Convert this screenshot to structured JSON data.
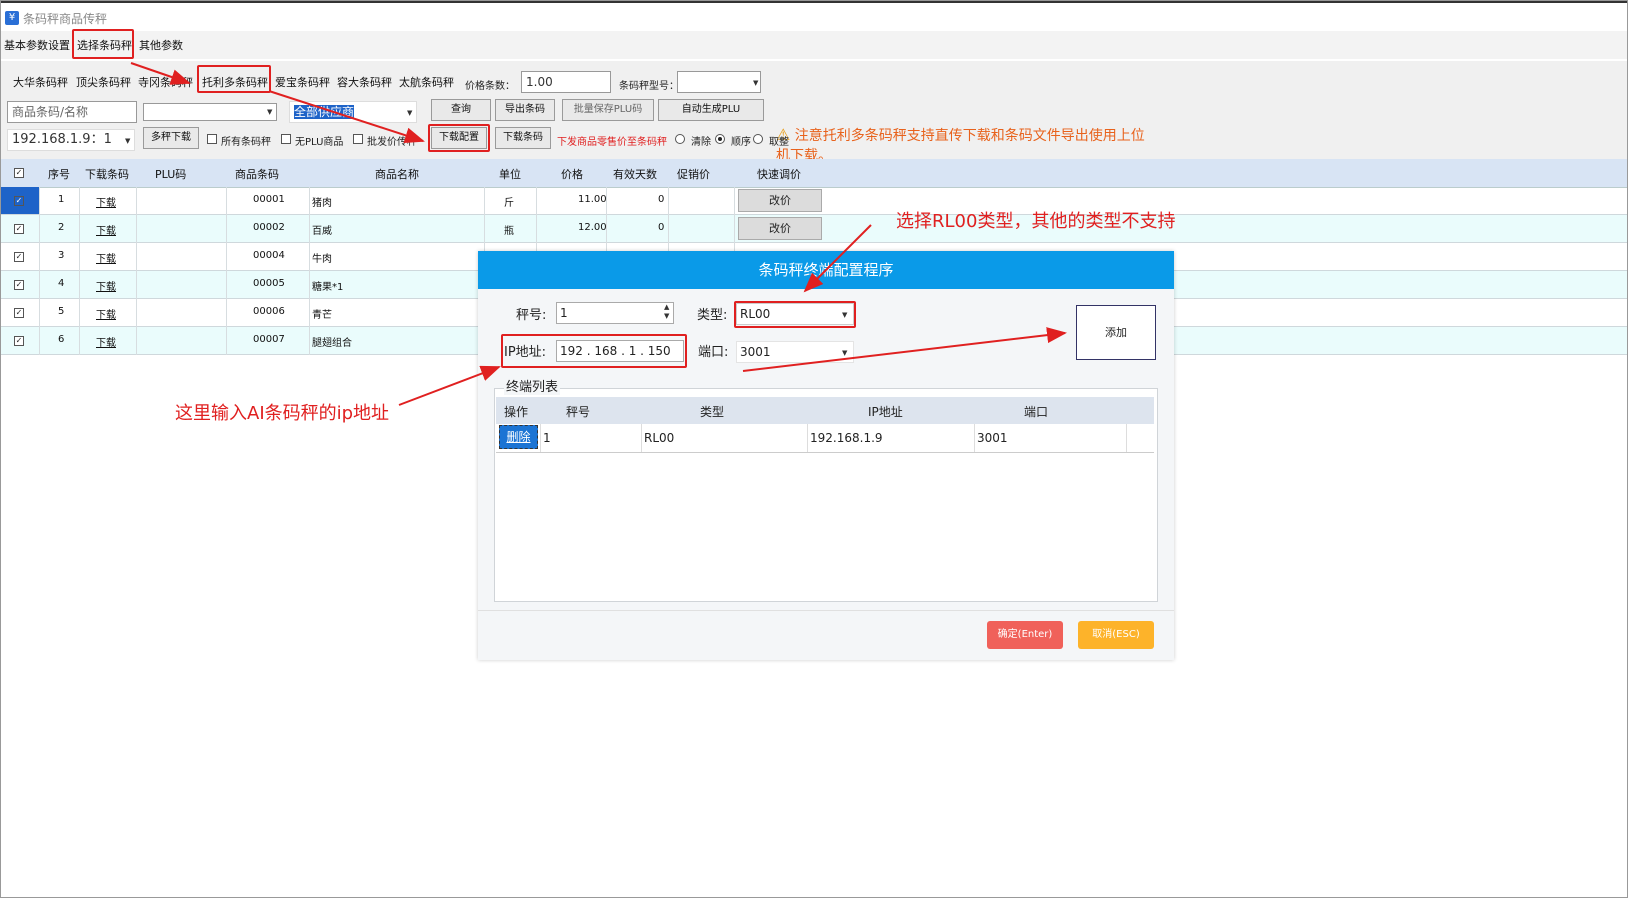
{
  "window": {
    "title": "条码秤商品传秤",
    "icon": "app-icon"
  },
  "top_tabs": [
    "基本参数设置",
    "选择条码秤",
    "其他参数"
  ],
  "scale_tabs": [
    "大华条码秤",
    "顶尖条码秤",
    "寺冈条码秤",
    "托利多条码秤",
    "爱宝条码秤",
    "容大条码秤",
    "太航条码秤"
  ],
  "toolbar": {
    "price_digits_label": "价格条数：",
    "price_digits_value": "1.00",
    "scale_model_label": "条码秤型号：",
    "search_placeholder": "商品条码/名称",
    "supplier_value": "全部供应商",
    "query": "查询",
    "export_barcode": "导出条码",
    "batch_save_plu": "批量保存PLU码",
    "auto_generate_plu": "自动生成PLU",
    "ip_select": "192.168.1.9：1",
    "multi_download": "多秤下载",
    "all_scales": "所有条码秤",
    "no_plu": "无PLU商品",
    "wholesale_scale": "批发价传秤",
    "download_config": "下载配置",
    "download_barcode": "下载条码",
    "retail_notice": "下发商品零售价至条码秤",
    "clear": "清除",
    "order": "顺序",
    "round": "取整"
  },
  "warning": "注意托利多条码秤支持直传下载和条码文件导出使用上位机下载。",
  "grid": {
    "headers": [
      "序号",
      "下载条码",
      "PLU码",
      "商品条码",
      "商品名称",
      "单位",
      "价格",
      "有效天数",
      "促销价",
      "快速调价"
    ],
    "rows": [
      {
        "no": "1",
        "dl": "下载",
        "plu": "",
        "code": "00001",
        "name": "猪肉",
        "unit": "斤",
        "price": "11.00",
        "days": "0",
        "promo": "",
        "btn": "改价"
      },
      {
        "no": "2",
        "dl": "下载",
        "plu": "",
        "code": "00002",
        "name": "百威",
        "unit": "瓶",
        "price": "12.00",
        "days": "0",
        "promo": "",
        "btn": "改价"
      },
      {
        "no": "3",
        "dl": "下载",
        "plu": "",
        "code": "00004",
        "name": "牛肉",
        "unit": "",
        "price": "",
        "days": "",
        "promo": "",
        "btn": ""
      },
      {
        "no": "4",
        "dl": "下载",
        "plu": "",
        "code": "00005",
        "name": "糖果*1",
        "unit": "",
        "price": "",
        "days": "",
        "promo": "",
        "btn": ""
      },
      {
        "no": "5",
        "dl": "下载",
        "plu": "",
        "code": "00006",
        "name": "青芒",
        "unit": "",
        "price": "",
        "days": "",
        "promo": "",
        "btn": ""
      },
      {
        "no": "6",
        "dl": "下载",
        "plu": "",
        "code": "00007",
        "name": "腿翅组合",
        "unit": "",
        "price": "",
        "days": "",
        "promo": "",
        "btn": ""
      }
    ]
  },
  "dialog": {
    "title": "条码秤终端配置程序",
    "scale_no_label": "秤号:",
    "scale_no_value": "1",
    "type_label": "类型:",
    "type_value": "RL00",
    "ip_label": "IP地址:",
    "ip_value": "192 . 168 .  1  . 150",
    "port_label": "端口:",
    "port_value": "3001",
    "add": "添加",
    "list_title": "终端列表",
    "list_headers": [
      "操作",
      "秤号",
      "类型",
      "IP地址",
      "端口"
    ],
    "list_row": {
      "op": "删除",
      "no": "1",
      "type": "RL00",
      "ip": "192.168.1.9",
      "port": "3001"
    },
    "ok": "确定(Enter)",
    "cancel": "取消(ESC)"
  },
  "annotations": {
    "type_hint": "选择RL00类型，其他的类型不支持",
    "ip_hint": "这里输入AI条码秤的ip地址"
  }
}
